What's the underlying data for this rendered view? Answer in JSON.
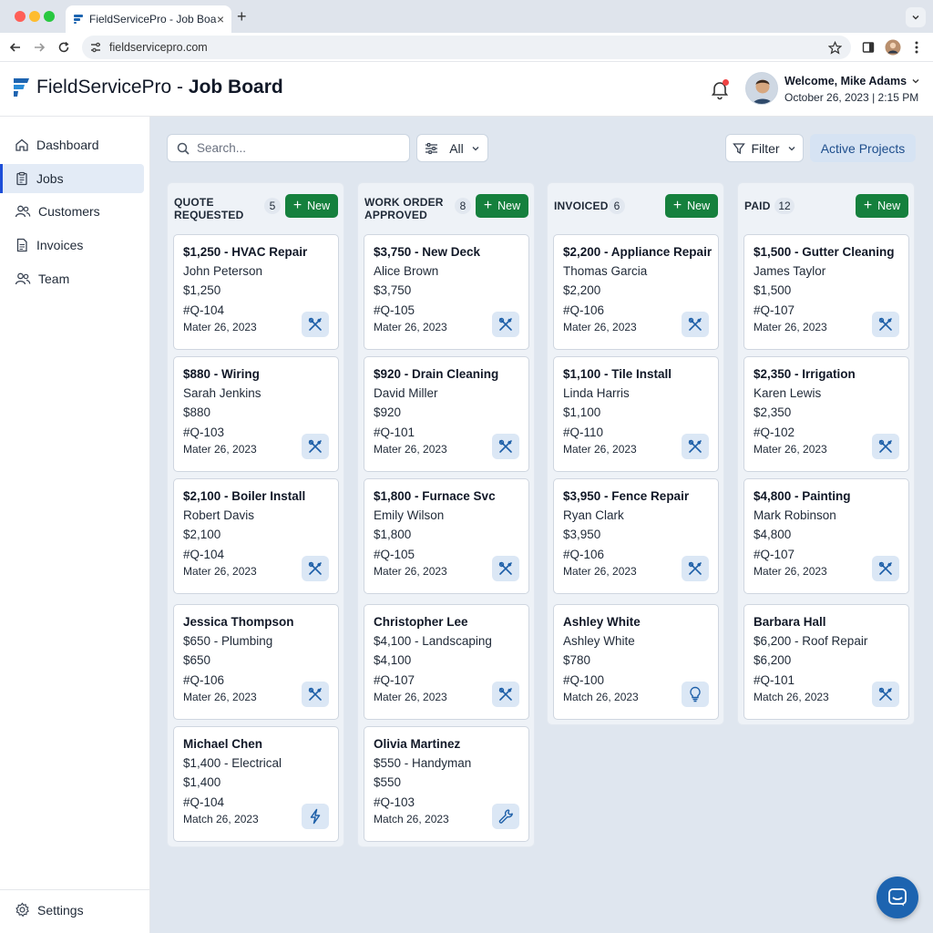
{
  "browser": {
    "tab_title": "FieldServicePro - Job Board",
    "tab_close": "×",
    "new_tab": "+",
    "url": "fieldservicepro.com"
  },
  "header": {
    "brand_name": "FieldServicePro - ",
    "page_name": "Job Board",
    "welcome": "Welcome, Mike Adams",
    "datetime": "October 26, 2023 | 2:15 PM",
    "notification_dot_color": "#ef4444"
  },
  "sidebar": {
    "items": [
      {
        "label": "Dashboard",
        "icon": "home-icon"
      },
      {
        "label": "Jobs",
        "icon": "clipboard-icon"
      },
      {
        "label": "Customers",
        "icon": "users-icon"
      },
      {
        "label": "Invoices",
        "icon": "document-icon"
      },
      {
        "label": "Team",
        "icon": "team-icon"
      }
    ],
    "active": "Jobs",
    "settings_label": "Settings"
  },
  "toolbar": {
    "search_placeholder": "Search...",
    "all_label": "All",
    "filter_label": "Filter",
    "active_projects_label": "Active Projects"
  },
  "board": {
    "new_label": "New",
    "columns": [
      {
        "title": "QUOTE REQUESTED",
        "count": "5",
        "cards": [
          {
            "title": "$1,250 - HVAC Repair",
            "line2": "John Peterson",
            "line3": "$1,250",
            "ref": "#Q-104",
            "date": "Mater 26, 2023",
            "icon": "tools-icon"
          },
          {
            "title": "$880 - Wiring",
            "line2": "Sarah Jenkins",
            "line3": "$880",
            "ref": "#Q-103",
            "date": "Mater 26, 2023",
            "icon": "tools-icon"
          },
          {
            "title": "$2,100 - Boiler Install",
            "line2": "Robert Davis",
            "line3": "$2,100",
            "ref": "#Q-104",
            "date": "Mater 26, 2023",
            "icon": "tools-icon"
          },
          {
            "title": "Jessica Thompson",
            "line2": "$650 - Plumbing",
            "line3": "$650",
            "ref": "#Q-106",
            "date": "Mater 26, 2023",
            "icon": "tools-icon"
          },
          {
            "title": "Michael Chen",
            "line2": "$1,400 - Electrical",
            "line3": "$1,400",
            "ref": "#Q-104",
            "date": "Match 26, 2023",
            "icon": "lightning-icon"
          }
        ]
      },
      {
        "title": "WORK ORDER APPROVED",
        "count": "8",
        "cards": [
          {
            "title": "$3,750 - New Deck",
            "line2": "Alice Brown",
            "line3": "$3,750",
            "ref": "#Q-105",
            "date": "Mater 26, 2023",
            "icon": "tools-icon"
          },
          {
            "title": "$920 - Drain Cleaning",
            "line2": "David Miller",
            "line3": "$920",
            "ref": "#Q-101",
            "date": "Mater 26, 2023",
            "icon": "tools-icon"
          },
          {
            "title": "$1,800 - Furnace Svc",
            "line2": "Emily Wilson",
            "line3": "$1,800",
            "ref": "#Q-105",
            "date": "Mater 26, 2023",
            "icon": "tools-icon"
          },
          {
            "title": "Christopher Lee",
            "line2": "$4,100 - Landscaping",
            "line3": "$4,100",
            "ref": "#Q-107",
            "date": "Mater 26, 2023",
            "icon": "tools-icon"
          },
          {
            "title": "Olivia Martinez",
            "line2": "$550 - Handyman",
            "line3": "$550",
            "ref": "#Q-103",
            "date": "Match 26, 2023",
            "icon": "wrench-icon"
          }
        ]
      },
      {
        "title": "INVOICED",
        "count": "6",
        "cards": [
          {
            "title": "$2,200 - Appliance Repair",
            "line2": "Thomas Garcia",
            "line3": "$2,200",
            "ref": "#Q-106",
            "date": "Mater 26, 2023",
            "icon": "tools-icon"
          },
          {
            "title": "$1,100 - Tile Install",
            "line2": "Linda Harris",
            "line3": "$1,100",
            "ref": "#Q-110",
            "date": "Mater 26, 2023",
            "icon": "tools-icon"
          },
          {
            "title": "$3,950 - Fence Repair",
            "line2": "Ryan Clark",
            "line3": "$3,950",
            "ref": "#Q-106",
            "date": "Mater 26, 2023",
            "icon": "tools-icon"
          },
          {
            "title": "Ashley White",
            "line2": "Ashley White",
            "line3": "$780",
            "ref": "#Q-100",
            "date": "Match 26, 2023",
            "icon": "lightbulb-icon"
          }
        ]
      },
      {
        "title": "PAID",
        "count": "12",
        "cards": [
          {
            "title": "$1,500 - Gutter Cleaning",
            "line2": "James Taylor",
            "line3": "$1,500",
            "ref": "#Q-107",
            "date": "Mater 26, 2023",
            "icon": "tools-icon"
          },
          {
            "title": "$2,350 - Irrigation",
            "line2": "Karen Lewis",
            "line3": "$2,350",
            "ref": "#Q-102",
            "date": "Mater 26, 2023",
            "icon": "tools-icon"
          },
          {
            "title": "$4,800 - Painting",
            "line2": "Mark Robinson",
            "line3": "$4,800",
            "ref": "#Q-107",
            "date": "Mater 26, 2023",
            "icon": "tools-icon"
          },
          {
            "title": "Barbara Hall",
            "line2": "$6,200 - Roof Repair",
            "line3": "$6,200",
            "ref": "#Q-101",
            "date": "Match 26, 2023",
            "icon": "tools-icon"
          }
        ]
      }
    ]
  },
  "colors": {
    "accent_green": "#15803d",
    "accent_blue": "#1d64b0",
    "active_nav_bg": "#e3ebf6"
  }
}
